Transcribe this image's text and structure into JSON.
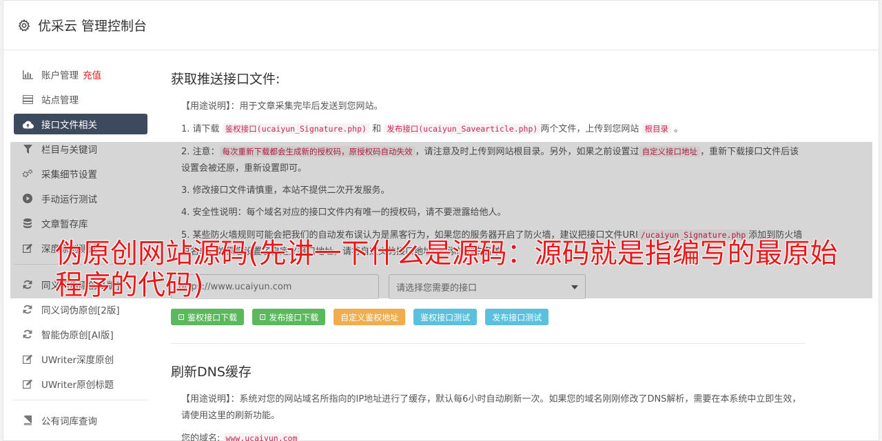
{
  "app": {
    "title": "优采云 管理控制台",
    "icon": "gear-icon"
  },
  "sidebar": {
    "group1": [
      {
        "label": "账户管理",
        "extra": "充值",
        "icon": "bar-chart-icon"
      },
      {
        "label": "站点管理",
        "icon": "server-icon"
      },
      {
        "label": "接口文件相关",
        "icon": "cloud-upload-icon",
        "active": true
      },
      {
        "label": "栏目与关键词",
        "icon": "filter-icon"
      },
      {
        "label": "采集细节设置",
        "icon": "cogs-icon"
      },
      {
        "label": "手动运行测试",
        "icon": "play-circle-icon"
      },
      {
        "label": "文章暂存库",
        "icon": "database-icon"
      },
      {
        "label": "深度原创测试",
        "icon": "edit-icon"
      }
    ],
    "group2": [
      {
        "label": "同义词伪原创[1版]",
        "icon": "refresh-icon"
      },
      {
        "label": "同义词伪原创[2版]",
        "icon": "refresh-icon"
      },
      {
        "label": "智能伪原创[AI版]",
        "icon": "refresh-icon"
      },
      {
        "label": "UWriter深度原创",
        "icon": "edit-icon"
      },
      {
        "label": "UWriter原创标题",
        "icon": "edit-icon"
      }
    ],
    "group3": [
      {
        "label": "公有词库查询",
        "icon": "book-icon"
      }
    ]
  },
  "section1": {
    "title": "获取推送接口文件:",
    "usage": "【用途说明】：用于文章采集完毕后发送到您网站。",
    "step1": {
      "a": "1. 请下载",
      "sig": "鉴权接口(ucaiyun_Signature.php)",
      "and": "和",
      "save": "发布接口(ucaiyun_Savearticle.php)",
      "b": "两个文件，上传到您网站",
      "root": "根目录",
      "c": "。"
    },
    "step2": {
      "a": "2. 注意：",
      "warn": "每次重新下载都会生成新的授权码，原授权码自动失效",
      "b": "，请注意及时上传到网站根目录。另外，如果之前设置过",
      "custom": "自定义接口地址",
      "c": "，重新下载接口文件后该设置会被还原，重新设置即可。"
    },
    "step3": "3. 修改接口文件请慎重，本站不提供二次开发服务。",
    "step4": "4. 安全性说明：每个域名对应的接口文件内有唯一的授权码，请不要泄露给他人。",
    "step5": {
      "a": "5. 某些防火墙规则可能会把我们的自动发布误认为是黑客行为，如果您的服务器开启了防火墙，建议把接口文件URI",
      "uri": "/ucaiyun_Signature.php",
      "b": "添加到防火墙白名单。如果您设置了自定义接口地址，请将自定义的接口地址URI添加到白名单。"
    },
    "url_placeholder": "https://www.ucaiyun.com",
    "select_placeholder": "请选择您需要的接口",
    "buttons": {
      "sig_download": "鉴权接口下载",
      "save_download": "发布接口下载",
      "custom_auth": "自定义鉴权地址",
      "sig_test": "鉴权接口测试",
      "save_test": "发布接口测试"
    }
  },
  "section2": {
    "title": "刷新DNS缓存",
    "usage": "【用途说明】：系统对您的网站域名所指向的IP地址进行了缓存，默认每6小时自动刷新一次。如果您的域名刚刚修改了DNS解析，需要在本系统中立即生效，请使用这里的刷新功能。",
    "domain_label": "您的域名:",
    "domain_value": "www.ucaiyun.com"
  },
  "banner": "伪原创网站源码(先讲一下什么是源码：源码就是指编写的最原始程序的代码)"
}
